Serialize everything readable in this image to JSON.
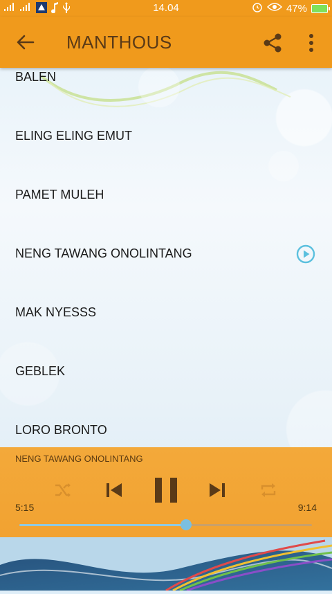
{
  "status_bar": {
    "time": "14.04",
    "battery": "47%",
    "icons": [
      "signal-icon",
      "signal-icon",
      "app-icon",
      "music-note-icon",
      "usb-icon",
      "alarm-icon",
      "eye-icon",
      "battery-icon"
    ]
  },
  "app_bar": {
    "title": "MANTHOUS",
    "icons": [
      "back-arrow-icon",
      "share-icon",
      "more-vert-icon"
    ]
  },
  "songs": [
    {
      "label": "BALEN",
      "playing": false
    },
    {
      "label": "ELING ELING EMUT",
      "playing": false
    },
    {
      "label": "PAMET MULEH",
      "playing": false
    },
    {
      "label": "NENG TAWANG ONOLINTANG",
      "playing": true
    },
    {
      "label": "MAK NYESSS",
      "playing": false
    },
    {
      "label": "GEBLEK",
      "playing": false
    },
    {
      "label": "LORO BRONTO",
      "playing": false
    }
  ],
  "player": {
    "now_playing": "NENG TAWANG ONOLINTANG",
    "elapsed": "5:15",
    "duration": "9:14",
    "progress": 0.57,
    "icons": [
      "shuffle-icon",
      "skip-previous-icon",
      "pause-icon",
      "skip-next-icon",
      "repeat-icon"
    ]
  },
  "colors": {
    "accent": "#f09a1c",
    "title_text": "#5a3a17",
    "play_indicator": "#5bc0de"
  }
}
